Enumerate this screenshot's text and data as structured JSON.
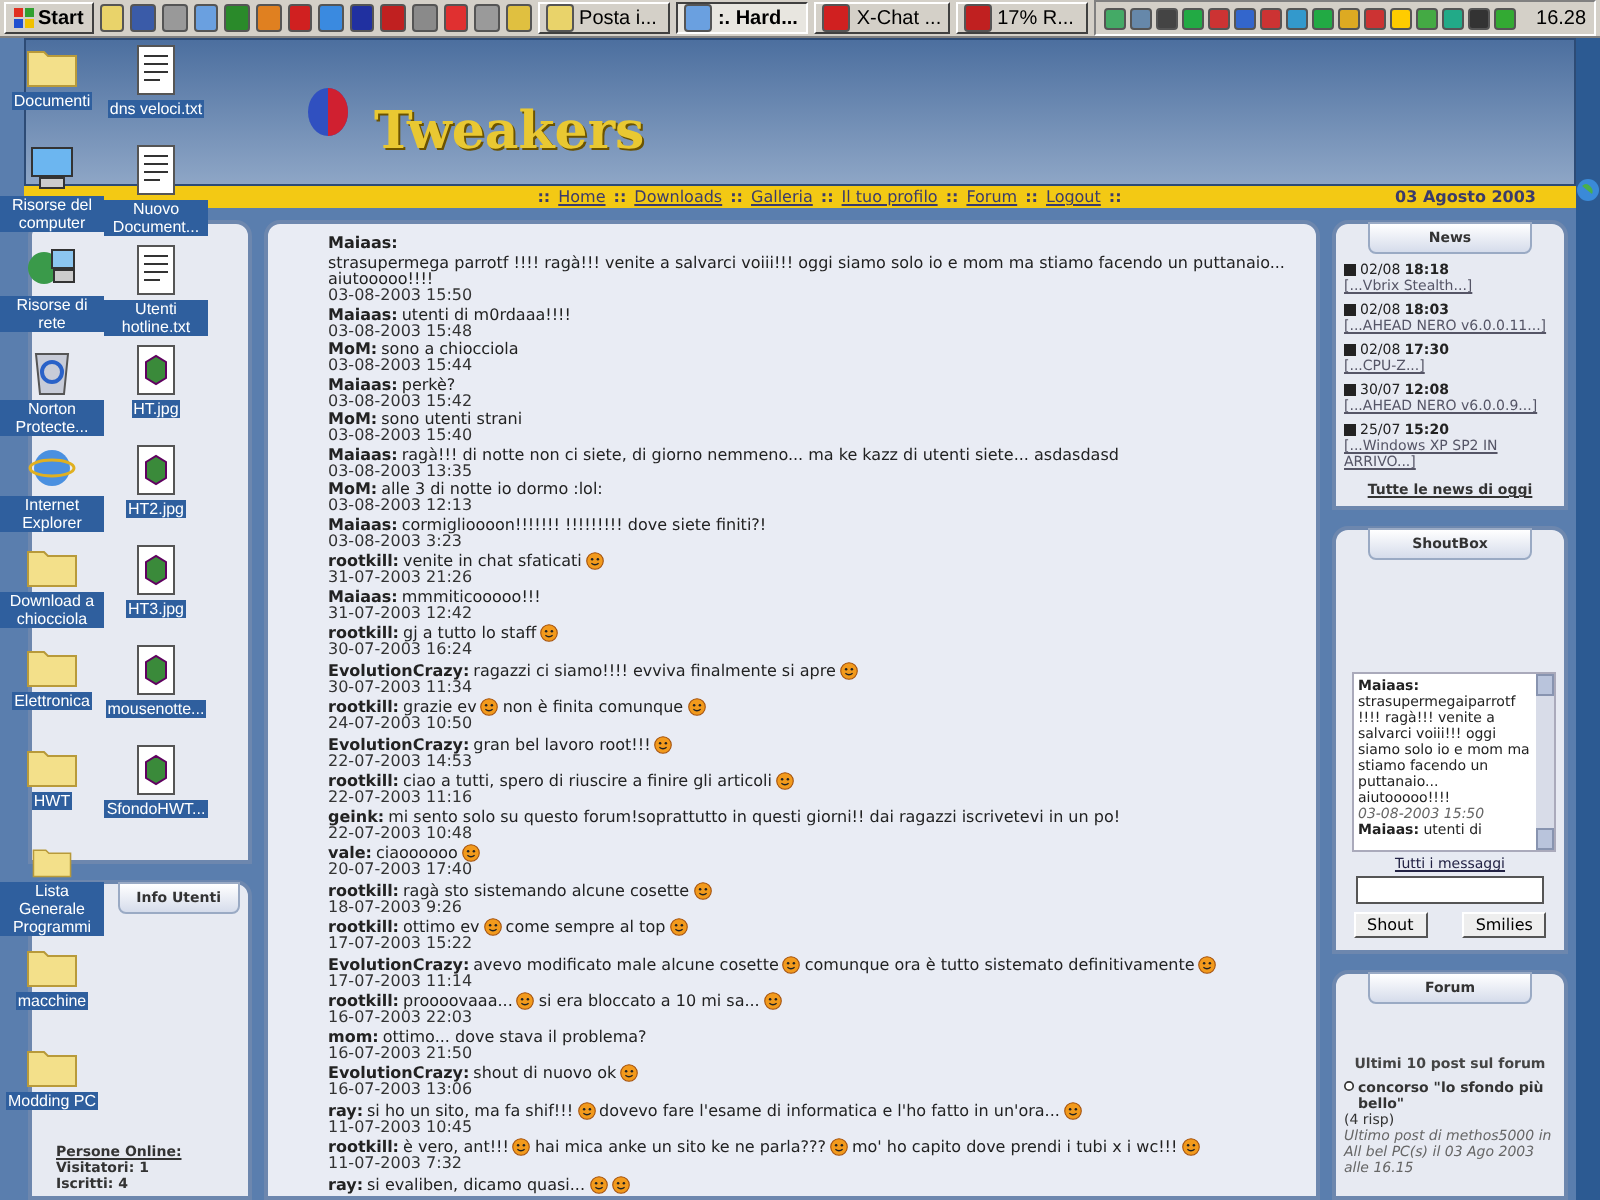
{
  "taskbar": {
    "start": "Start",
    "tasks": [
      {
        "label": "Posta i...",
        "selected": false
      },
      {
        "label": ":. Hard...",
        "selected": true
      },
      {
        "label": "X-Chat ...",
        "selected": false
      },
      {
        "label": "17% R...",
        "selected": false
      }
    ],
    "clock": "16.28"
  },
  "desktop": {
    "columns": [
      [
        {
          "label": "Documenti",
          "kind": "folder"
        },
        {
          "label": "Risorse del computer",
          "kind": "computer"
        },
        {
          "label": "Risorse di rete",
          "kind": "network"
        },
        {
          "label": "Norton Protecte...",
          "kind": "bin"
        },
        {
          "label": "Internet Explorer",
          "kind": "browser"
        },
        {
          "label": "Download a chiocciola",
          "kind": "folder"
        },
        {
          "label": "Elettronica",
          "kind": "folder"
        },
        {
          "label": "HWT",
          "kind": "folder"
        },
        {
          "label": "Lista Generale Programmi",
          "kind": "folder"
        },
        {
          "label": "macchine",
          "kind": "folder"
        },
        {
          "label": "Modding PC",
          "kind": "folder"
        }
      ],
      [
        {
          "label": "dns veloci.txt",
          "kind": "text"
        },
        {
          "label": "Nuovo Document...",
          "kind": "text"
        },
        {
          "label": "Utenti hotline.txt",
          "kind": "text"
        },
        {
          "label": "HT.jpg",
          "kind": "image"
        },
        {
          "label": "HT2.jpg",
          "kind": "image"
        },
        {
          "label": "HT3.jpg",
          "kind": "image"
        },
        {
          "label": "mousenotte...",
          "kind": "image"
        },
        {
          "label": "SfondoHWT...",
          "kind": "image"
        }
      ]
    ]
  },
  "header": {
    "logo": "Tweakers"
  },
  "nav": {
    "links": [
      "Home",
      "Downloads",
      "Galleria",
      "Il tuo profilo",
      "Forum",
      "Logout"
    ],
    "separator": "::",
    "date": "03 Agosto 2003"
  },
  "left": {
    "info_title": "Info Utenti",
    "online_title": "Persone Online:",
    "online": [
      "Visitatori: 1",
      "Iscritti: 4"
    ]
  },
  "shouts": [
    {
      "name": "Maiaas:",
      "date": "03-08-2003 15:50",
      "parts": [
        {
          "kind": "text",
          "text": "strasupermega parrotf !!!! ragà!!! venite a salvarci voiii!!! oggi siamo solo io e mom ma stiamo facendo un puttanaio... aiutooooo!!!!"
        }
      ]
    },
    {
      "name": "Maiaas:",
      "date": "03-08-2003 15:48",
      "parts": [
        {
          "kind": "text",
          "text": "utenti di m0rdaaa!!!!"
        }
      ]
    },
    {
      "name": "MoM:",
      "date": "03-08-2003 15:44",
      "parts": [
        {
          "kind": "text",
          "text": "sono a chiocciola"
        }
      ]
    },
    {
      "name": "Maiaas:",
      "date": "03-08-2003 15:42",
      "parts": [
        {
          "kind": "text",
          "text": "perkè?"
        }
      ]
    },
    {
      "name": "MoM:",
      "date": "03-08-2003 15:40",
      "parts": [
        {
          "kind": "text",
          "text": "sono utenti strani"
        }
      ]
    },
    {
      "name": "Maiaas:",
      "date": "03-08-2003 13:35",
      "parts": [
        {
          "kind": "text",
          "text": "ragà!!! di notte non ci siete, di giorno nemmeno... ma ke kazz di utenti siete... asdasdasd"
        }
      ]
    },
    {
      "name": "MoM:",
      "date": "03-08-2003 12:13",
      "parts": [
        {
          "kind": "text",
          "text": "alle 3 di notte io dormo :lol:"
        }
      ]
    },
    {
      "name": "Maiaas:",
      "date": "03-08-2003 3:23",
      "parts": [
        {
          "kind": "text",
          "text": "cormiglioooon!!!!!!! !!!!!!!!! dove siete finiti?!"
        }
      ]
    },
    {
      "name": "rootkill:",
      "date": "31-07-2003 21:26",
      "parts": [
        {
          "kind": "text",
          "text": "venite in chat sfaticati"
        },
        {
          "kind": "smiley"
        }
      ]
    },
    {
      "name": "Maiaas:",
      "date": "31-07-2003 12:42",
      "parts": [
        {
          "kind": "text",
          "text": "mmmiticooooo!!!"
        }
      ]
    },
    {
      "name": "rootkill:",
      "date": "30-07-2003 16:24",
      "parts": [
        {
          "kind": "text",
          "text": "gj a tutto lo staff"
        },
        {
          "kind": "smiley"
        }
      ]
    },
    {
      "name": "EvolutionCrazy:",
      "date": "30-07-2003 11:34",
      "parts": [
        {
          "kind": "text",
          "text": "ragazzi ci siamo!!!! evviva finalmente si apre"
        },
        {
          "kind": "smiley"
        }
      ]
    },
    {
      "name": "rootkill:",
      "date": "24-07-2003 10:50",
      "parts": [
        {
          "kind": "text",
          "text": "grazie ev"
        },
        {
          "kind": "smiley"
        },
        {
          "kind": "text",
          "text": "non è finita comunque"
        },
        {
          "kind": "smiley"
        }
      ]
    },
    {
      "name": "EvolutionCrazy:",
      "date": "22-07-2003 14:53",
      "parts": [
        {
          "kind": "text",
          "text": "gran bel lavoro root!!!"
        },
        {
          "kind": "smiley"
        }
      ]
    },
    {
      "name": "rootkill:",
      "date": "22-07-2003 11:16",
      "parts": [
        {
          "kind": "text",
          "text": "ciao a tutti, spero di riuscire a finire gli articoli"
        },
        {
          "kind": "smiley"
        }
      ]
    },
    {
      "name": "geink:",
      "date": "22-07-2003 10:48",
      "parts": [
        {
          "kind": "text",
          "text": "mi sento solo su questo forum!soprattutto in questi giorni!! dai ragazzi iscrivetevi in un po!"
        }
      ]
    },
    {
      "name": "vale:",
      "date": "20-07-2003 17:40",
      "parts": [
        {
          "kind": "text",
          "text": "ciaoooooo"
        },
        {
          "kind": "smiley"
        }
      ]
    },
    {
      "name": "rootkill:",
      "date": "18-07-2003 9:26",
      "parts": [
        {
          "kind": "text",
          "text": "ragà sto sistemando alcune cosette"
        },
        {
          "kind": "smiley"
        }
      ]
    },
    {
      "name": "rootkill:",
      "date": "17-07-2003 15:22",
      "parts": [
        {
          "kind": "text",
          "text": "ottimo ev"
        },
        {
          "kind": "smiley"
        },
        {
          "kind": "text",
          "text": "come sempre al top"
        },
        {
          "kind": "smiley"
        }
      ]
    },
    {
      "name": "EvolutionCrazy:",
      "date": "17-07-2003 11:14",
      "parts": [
        {
          "kind": "text",
          "text": "avevo modificato male alcune cosette"
        },
        {
          "kind": "smiley"
        },
        {
          "kind": "text",
          "text": "comunque ora è tutto sistemato definitivamente"
        },
        {
          "kind": "smiley"
        }
      ]
    },
    {
      "name": "rootkill:",
      "date": "16-07-2003 22:03",
      "parts": [
        {
          "kind": "text",
          "text": "proooovaaa..."
        },
        {
          "kind": "smiley"
        },
        {
          "kind": "text",
          "text": "si era bloccato a 10 mi sa..."
        },
        {
          "kind": "smiley"
        }
      ]
    },
    {
      "name": "mom:",
      "date": "16-07-2003 21:50",
      "parts": [
        {
          "kind": "text",
          "text": "ottimo... dove stava il problema?"
        }
      ]
    },
    {
      "name": "EvolutionCrazy:",
      "date": "16-07-2003 13:06",
      "parts": [
        {
          "kind": "text",
          "text": "shout di nuovo ok"
        },
        {
          "kind": "smiley"
        }
      ]
    },
    {
      "name": "ray:",
      "date": "11-07-2003 10:45",
      "parts": [
        {
          "kind": "text",
          "text": "si ho un sito, ma fa shif!!!"
        },
        {
          "kind": "smiley"
        },
        {
          "kind": "text",
          "text": "dovevo fare l'esame di informatica e l'ho fatto in un'ora..."
        },
        {
          "kind": "smiley"
        }
      ]
    },
    {
      "name": "rootkill:",
      "date": "11-07-2003 7:32",
      "parts": [
        {
          "kind": "text",
          "text": "è vero, ant!!!"
        },
        {
          "kind": "smiley"
        },
        {
          "kind": "text",
          "text": "hai mica anke un sito ke ne parla???"
        },
        {
          "kind": "smiley"
        },
        {
          "kind": "text",
          "text": "mo' ho capito dove prendi i tubi x i wc!!!"
        },
        {
          "kind": "smiley"
        }
      ]
    },
    {
      "name": "ray:",
      "parts": [
        {
          "kind": "text",
          "text": "si evaliben, dicamo quasi..."
        },
        {
          "kind": "smiley"
        },
        {
          "kind": "smiley"
        }
      ]
    }
  ],
  "news": {
    "title": "News",
    "items": [
      {
        "date": "02/08",
        "time": "18:18",
        "title": "[...Vbrix Stealth...]"
      },
      {
        "date": "02/08",
        "time": "18:03",
        "title": "[...AHEAD NERO v6.0.0.11...]"
      },
      {
        "date": "02/08",
        "time": "17:30",
        "title": "[...CPU-Z...]"
      },
      {
        "date": "30/07",
        "time": "12:08",
        "title": "[...AHEAD NERO v6.0.0.9...]"
      },
      {
        "date": "25/07",
        "time": "15:20",
        "title": "[...Windows XP SP2 IN ARRIVO...]"
      }
    ],
    "all": "Tutte le news di oggi"
  },
  "shoutbox": {
    "title": "ShoutBox",
    "messages": [
      {
        "name": "Maiaas:",
        "text": "strasupermegaiparrotf !!!! ragà!!! venite a salvarci voiii!!! oggi siamo solo io e mom ma stiamo facendo un puttanaio... aiutooooo!!!!",
        "date": "03-08-2003 15:50"
      },
      {
        "name": "Maiaas:",
        "text": "utenti di"
      }
    ],
    "all": "Tutti i messaggi",
    "buttons": [
      "Shout",
      "Smilies"
    ]
  },
  "forum": {
    "title": "Forum",
    "subtitle": "Ultimi 10 post sul forum",
    "posts": [
      {
        "topic": "concorso \"lo sfondo più bello\"",
        "replies": "(4 risp)",
        "last": "Ultimo post di methos5000 in All bel PC(s) il 03 Ago 2003 alle 16.15"
      }
    ]
  }
}
